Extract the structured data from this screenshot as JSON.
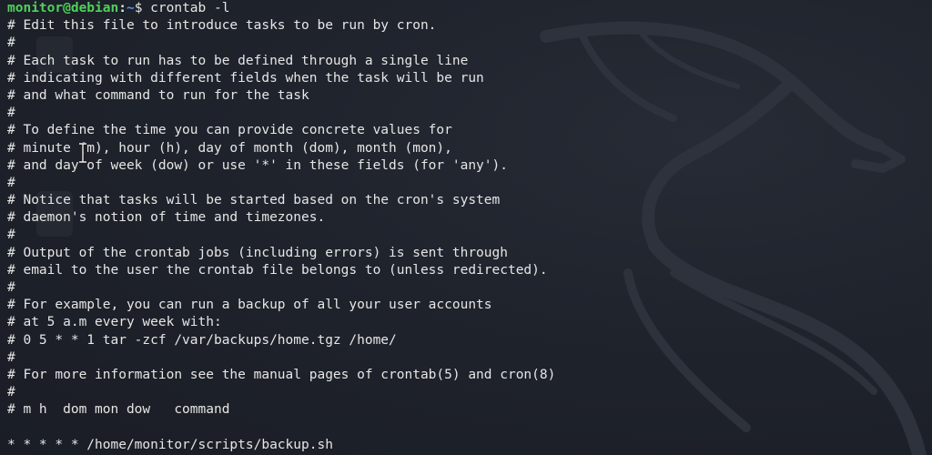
{
  "prompt": {
    "user_host": "monitor@debian",
    "separator": ":",
    "path": "~",
    "symbol": "$",
    "command": " crontab -l"
  },
  "output_lines": [
    "# Edit this file to introduce tasks to be run by cron.",
    "#",
    "# Each task to run has to be defined through a single line",
    "# indicating with different fields when the task will be run",
    "# and what command to run for the task",
    "#",
    "# To define the time you can provide concrete values for",
    "# minute (m), hour (h), day of month (dom), month (mon),",
    "# and day of week (dow) or use '*' in these fields (for 'any').",
    "#",
    "# Notice that tasks will be started based on the cron's system",
    "# daemon's notion of time and timezones.",
    "#",
    "# Output of the crontab jobs (including errors) is sent through",
    "# email to the user the crontab file belongs to (unless redirected).",
    "#",
    "# For example, you can run a backup of all your user accounts",
    "# at 5 a.m every week with:",
    "# 0 5 * * 1 tar -zcf /var/backups/home.tgz /home/",
    "#",
    "# For more information see the manual pages of crontab(5) and cron(8)",
    "#",
    "# m h  dom mon dow   command",
    "",
    "* * * * * /home/monitor/scripts/backup.sh"
  ],
  "colors": {
    "background": "#1d2129",
    "text": "#e6e6e6",
    "user_host": "#4fd15a",
    "path": "#5b8cf5"
  },
  "icons": {
    "wallpaper": "kali-dragon-icon",
    "cursor": "text-cursor-icon"
  }
}
